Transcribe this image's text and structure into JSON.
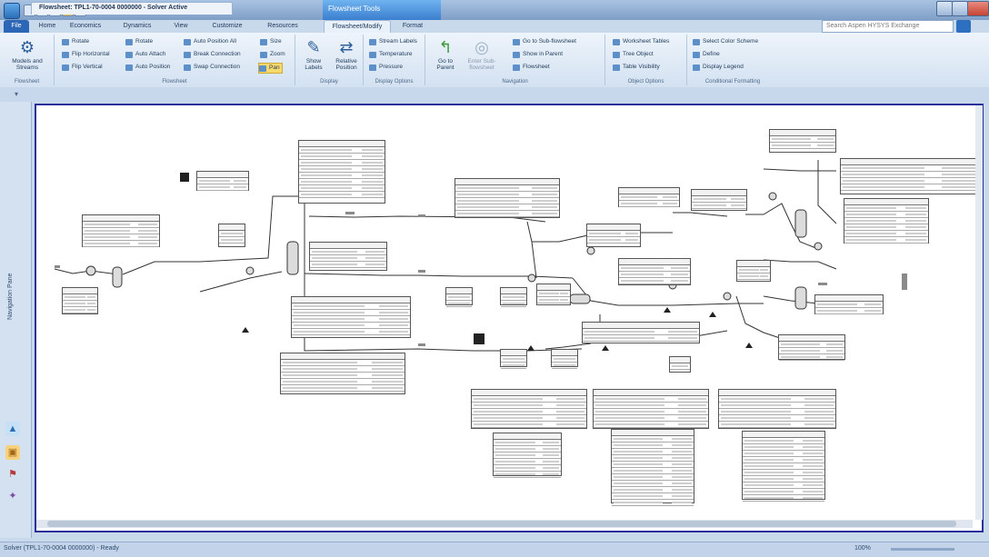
{
  "window": {
    "context_group_label": "Flowsheet Tools",
    "search_placeholder": "Search Aspen HYSYS Exchange"
  },
  "tabs": [
    {
      "label": "File"
    },
    {
      "label": "Home"
    },
    {
      "label": "Economics"
    },
    {
      "label": "Dynamics"
    },
    {
      "label": "View"
    },
    {
      "label": "Customize"
    },
    {
      "label": "Resources"
    },
    {
      "label": "Flowsheet/Modify"
    },
    {
      "label": "Format"
    }
  ],
  "ribbon": {
    "groups": [
      {
        "label": "Flowsheet",
        "items": [
          "Models and Streams"
        ]
      },
      {
        "label": "Flowsheet",
        "items": [
          "Rotate",
          "Flip Horizontal",
          "Flip Vertical",
          "Rotate",
          "Auto Attach",
          "Auto Position",
          "Auto Position All",
          "Break Connection",
          "Swap Connection",
          "Size",
          "Zoom",
          "Pan"
        ]
      },
      {
        "label": "Display",
        "items": [
          "Show Labels",
          "Relative Position"
        ]
      },
      {
        "label": "Display Options",
        "items": [
          "Stream Labels",
          "Temperature",
          "Pressure"
        ]
      },
      {
        "label": "Navigation",
        "items": [
          "Go to Parent",
          "Go to Sub-flowsheet",
          "Show in Parent",
          "Enter Sub-flowsheet",
          "Flowsheet"
        ]
      },
      {
        "label": "Object Options",
        "items": [
          "Worksheet Tables",
          "Tree Object",
          "Table Visibility"
        ]
      },
      {
        "label": "Conditional Formatting",
        "items": [
          "Select Color Scheme",
          "Define",
          "Display Legend"
        ]
      }
    ]
  },
  "document_tab": {
    "title": "Flowsheet: TPL1-70-0004 0000000 - Solver Active"
  },
  "nav_pane": {
    "label": "Navigation Pane"
  },
  "status_bar": {
    "text": "Solver (TPL1-70-0004 0000000) - Ready",
    "zoom": "100%"
  }
}
